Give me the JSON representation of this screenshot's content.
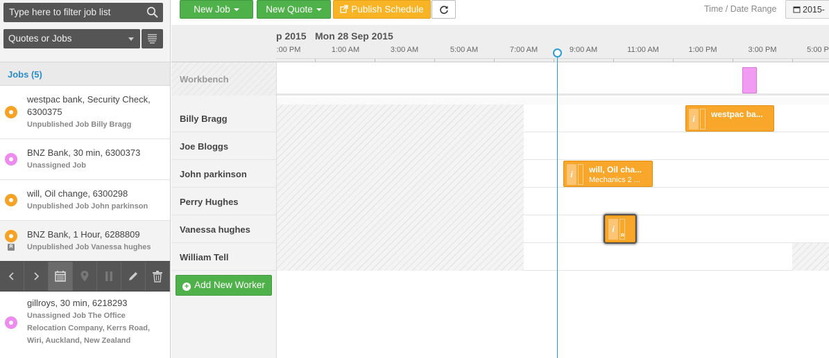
{
  "sidebar": {
    "filter_placeholder": "Type here to filter job list",
    "type_select": "Quotes or Jobs",
    "jobs_header": "Jobs (5)",
    "jobs": [
      {
        "title": "westpac bank, Security Check, 6300375",
        "sub": "Unpublished Job Billy Bragg",
        "status_color": "#f7a125"
      },
      {
        "title": "BNZ Bank, 30 min, 6300373",
        "sub": "Unassigned Job",
        "status_color": "#ee8bee"
      },
      {
        "title": "will, Oil change, 6300298",
        "sub": "Unpublished Job John parkinson",
        "status_color": "#f7a125"
      },
      {
        "title": "BNZ Bank, 1 Hour, 6288809",
        "sub": "Unpublished Job Vanessa hughes",
        "status_color": "#f7a125",
        "badge": "R"
      },
      {
        "title": "gillroys, 30 min, 6218293",
        "sub": "Unassigned Job The Office Relocation Company, Kerrs Road, Wiri, Auckland, New Zealand",
        "status_color": "#ee8bee"
      }
    ],
    "toolbar_icons": [
      "chevron-left-icon",
      "chevron-right-icon",
      "calendar-icon",
      "map-pin-icon",
      "pause-icon",
      "pencil-icon",
      "trash-icon"
    ]
  },
  "topbar": {
    "new_job": "New Job",
    "new_quote": "New Quote",
    "publish": "Publish Schedule",
    "time_date_range": "Time / Date Range",
    "date_value": "2015-"
  },
  "schedule": {
    "date_prev": "p 2015",
    "date_current": "Mon 28 Sep 2015",
    "times": [
      ":00 PM",
      "1:00 AM",
      "3:00 AM",
      "5:00 AM",
      "7:00 AM",
      "9:00 AM",
      "11:00 AM",
      "1:00 PM",
      "3:00 PM",
      "5:00 P"
    ],
    "workbench_label": "Workbench",
    "workers": [
      "Billy Bragg",
      "Joe Bloggs",
      "John parkinson",
      "Perry Hughes",
      "Vanessa hughes",
      "William Tell"
    ],
    "add_worker": "Add New Worker",
    "blocks": {
      "westpac": {
        "title": "westpac ba..."
      },
      "will": {
        "title": "will, Oil cha...",
        "sub": "Mechanics 2 ..."
      },
      "vanessa": {
        "badge": "R"
      }
    },
    "info_glyph": "i"
  }
}
